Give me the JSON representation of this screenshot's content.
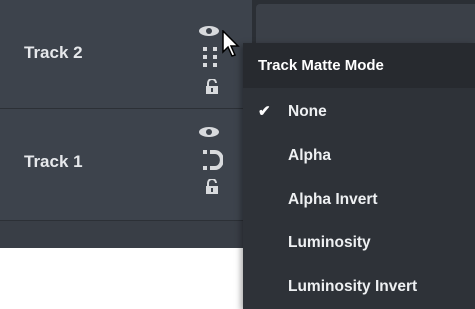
{
  "tracks": [
    {
      "label": "Track 2"
    },
    {
      "label": "Track 1"
    }
  ],
  "track_icons": [
    "eye-icon",
    "track-matte-icon",
    "lock-icon"
  ],
  "menu": {
    "title": "Track Matte Mode",
    "items": [
      {
        "label": "None",
        "checked": true
      },
      {
        "label": "Alpha",
        "checked": false
      },
      {
        "label": "Alpha Invert",
        "checked": false
      },
      {
        "label": "Luminosity",
        "checked": false
      },
      {
        "label": "Luminosity Invert",
        "checked": false
      }
    ],
    "check_mark": "✔"
  },
  "colors": {
    "panel": "#3d434c",
    "menu_bg": "#2e3238",
    "menu_title_bg": "#272a2f",
    "text": "#e6e8eb"
  }
}
